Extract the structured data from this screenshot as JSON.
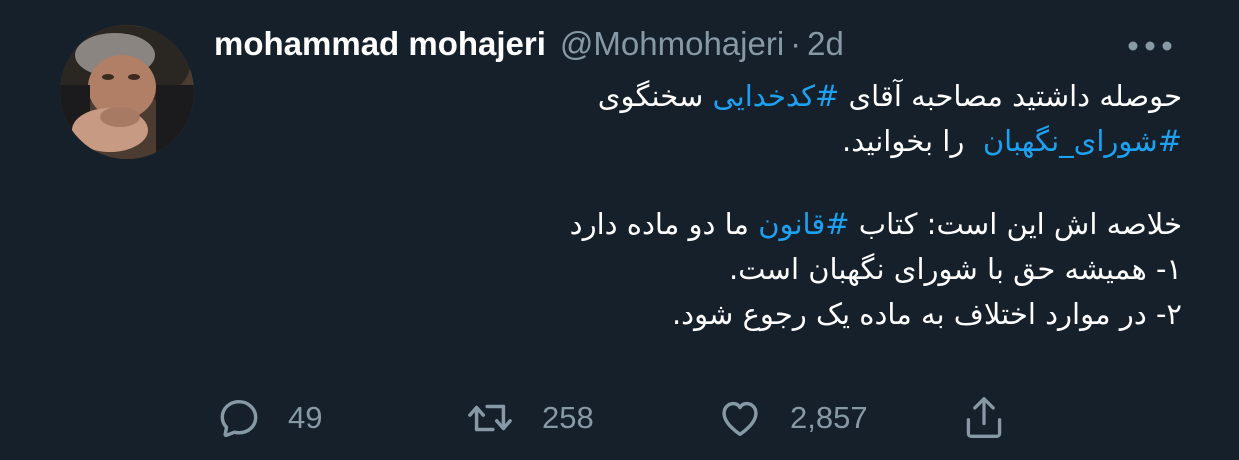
{
  "author": {
    "display_name": "mohammad mohajeri",
    "handle": "@Mohmohajeri",
    "separator": "·",
    "timestamp": "2d"
  },
  "more_icon": "more-dots-icon",
  "tweet": {
    "line1": {
      "before": "حوصله داشتید مصاحبه آقای ",
      "hashtag": "#کدخدایی",
      "after": " سخنگوی"
    },
    "line2": {
      "hashtag": "#شورای_نگهبان",
      "after": "  را بخوانید."
    },
    "line3": {
      "before": "خلاصه اش این است: کتاب ",
      "hashtag": "#قانون",
      "after": " ما دو ماده دارد"
    },
    "line4": "۱- همیشه حق با شورای نگهبان است.",
    "line5": "۲- در موارد اختلاف به ماده یک رجوع شود."
  },
  "actions": {
    "reply": {
      "icon": "reply-icon",
      "count": "49"
    },
    "retweet": {
      "icon": "retweet-icon",
      "count": "258"
    },
    "like": {
      "icon": "heart-icon",
      "count": "2,857"
    },
    "share": {
      "icon": "share-icon"
    }
  },
  "colors": {
    "background": "#15202b",
    "text": "#ffffff",
    "secondary": "#8899a6",
    "link": "#1da1f2"
  }
}
